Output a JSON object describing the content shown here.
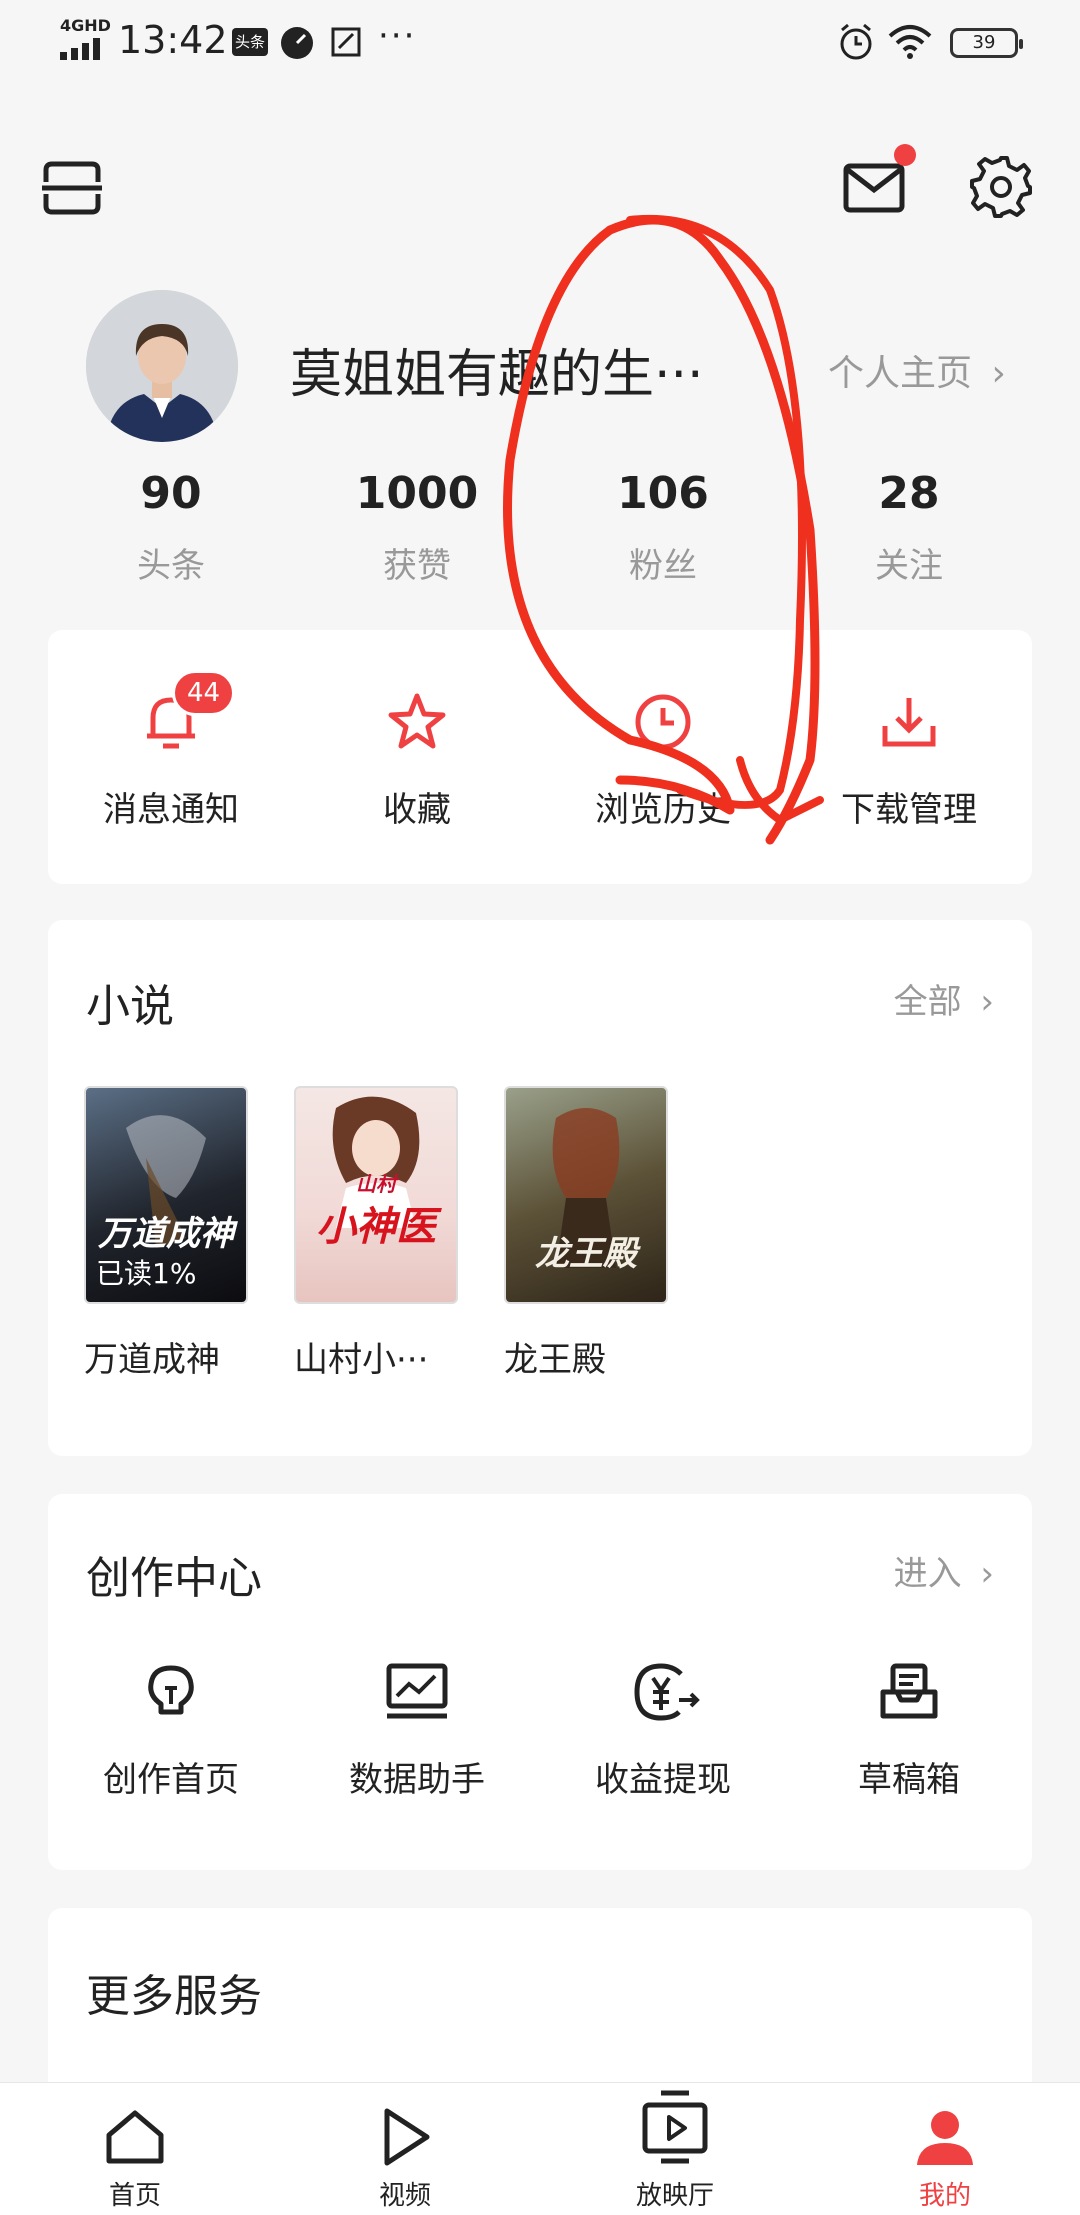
{
  "status_bar": {
    "network": "4GHD",
    "time": "13:42",
    "app_badge": "头条",
    "more": "···",
    "battery": "39"
  },
  "profile": {
    "username": "莫姐姐有趣的生···",
    "home_link": "个人主页"
  },
  "stats": [
    {
      "value": "90",
      "label": "头条"
    },
    {
      "value": "1000",
      "label": "获赞"
    },
    {
      "value": "106",
      "label": "粉丝"
    },
    {
      "value": "28",
      "label": "关注"
    }
  ],
  "quick_actions": [
    {
      "label": "消息通知",
      "icon": "bell-icon",
      "badge": "44"
    },
    {
      "label": "收藏",
      "icon": "star-icon"
    },
    {
      "label": "浏览历史",
      "icon": "clock-icon"
    },
    {
      "label": "下载管理",
      "icon": "download-icon"
    }
  ],
  "novels": {
    "title": "小说",
    "more": "全部",
    "books": [
      {
        "name": "万道成神",
        "cover_title": "万道成神",
        "progress_label": "已读1%",
        "progress": 1
      },
      {
        "name": "山村小···",
        "cover_title": "小神医",
        "cover_tag": "山村"
      },
      {
        "name": "龙王殿",
        "cover_title": "龙王殿"
      }
    ]
  },
  "creator_center": {
    "title": "创作中心",
    "more": "进入",
    "items": [
      {
        "label": "创作首页",
        "icon": "lightbulb-icon"
      },
      {
        "label": "数据助手",
        "icon": "chart-icon"
      },
      {
        "label": "收益提现",
        "icon": "yuan-icon"
      },
      {
        "label": "草稿箱",
        "icon": "draft-box-icon"
      }
    ]
  },
  "more_services": {
    "title": "更多服务"
  },
  "bottom_nav": [
    {
      "label": "首页",
      "icon": "home-icon"
    },
    {
      "label": "视频",
      "icon": "play-icon"
    },
    {
      "label": "放映厅",
      "icon": "tv-icon"
    },
    {
      "label": "我的",
      "icon": "person-icon",
      "active": true
    }
  ],
  "colors": {
    "accent": "#f04142",
    "annotation_scribble": "#f0301e",
    "text_primary": "#222222",
    "text_secondary": "#999999"
  }
}
